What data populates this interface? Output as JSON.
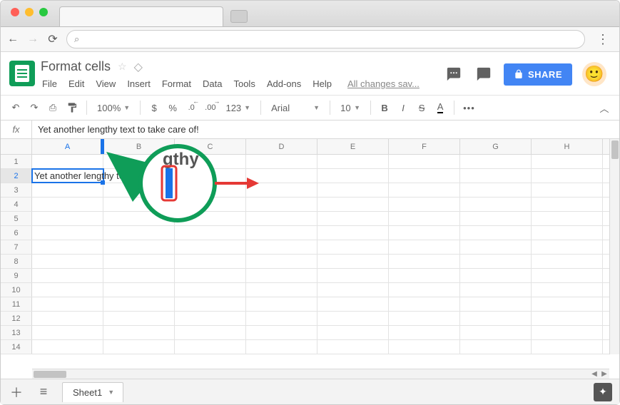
{
  "doc": {
    "title": "Format cells"
  },
  "menubar": [
    "File",
    "Edit",
    "View",
    "Insert",
    "Format",
    "Data",
    "Tools",
    "Add-ons",
    "Help"
  ],
  "status_saved": "All changes sav...",
  "share_label": "SHARE",
  "toolbar": {
    "zoom": "100%",
    "numfmt": "123",
    "font": "Arial",
    "fontsize": "10"
  },
  "formula": {
    "label": "fx",
    "value": "Yet another lengthy text to take care of!"
  },
  "columns": [
    "A",
    "B",
    "C",
    "D",
    "E",
    "F",
    "G",
    "H"
  ],
  "rows": [
    "1",
    "2",
    "3",
    "4",
    "5",
    "6",
    "7",
    "8",
    "9",
    "10",
    "11",
    "12",
    "13",
    "14"
  ],
  "cells": {
    "A2": "Yet another lengthy text to take care of!"
  },
  "annotation": {
    "zoom_text": "gthy"
  },
  "sheets": {
    "name": "Sheet1"
  },
  "glyph": {
    "currency": "$",
    "percent": "%",
    "dec_dec": ".0",
    "dec_inc": ".00",
    "bold": "B",
    "italic": "I",
    "strike": "S",
    "textcolor": "A",
    "more": "•••",
    "undo": "↶",
    "redo": "↷",
    "print": "⎙",
    "paint": "�ể"
  }
}
